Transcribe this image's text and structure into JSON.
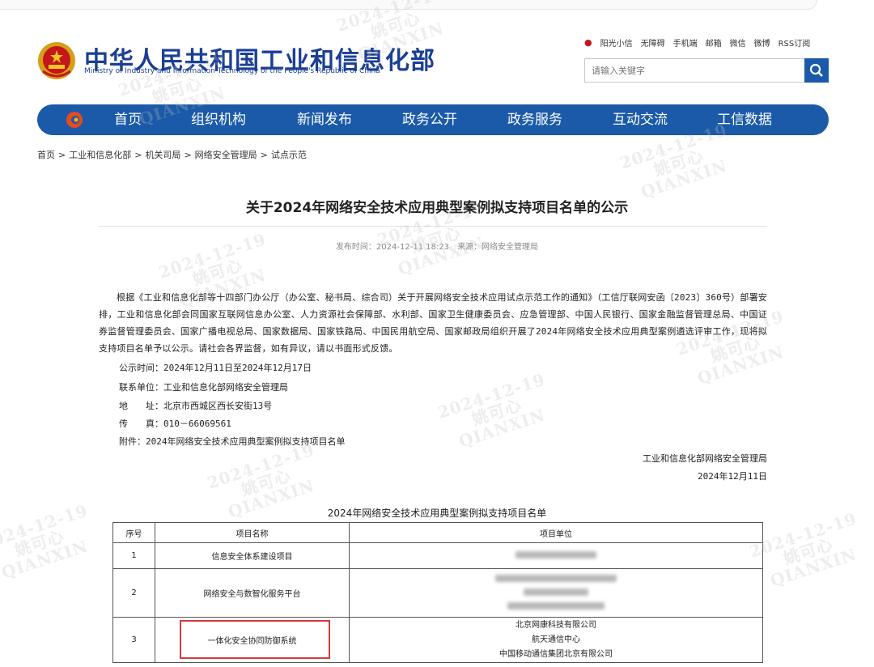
{
  "header": {
    "title_cn": "中华人民共和国工业和信息化部",
    "title_en": "Ministry of Industry and Information Technology of the People's Republic of China",
    "quick_links": [
      "阳光小信",
      "无障碍",
      "手机端",
      "邮箱",
      "微信",
      "微博",
      "RSS订阅"
    ],
    "search_placeholder": "请输入关键字"
  },
  "nav": {
    "items": [
      "首页",
      "组织机构",
      "新闻发布",
      "政务公开",
      "政务服务",
      "互动交流",
      "工信数据"
    ]
  },
  "breadcrumb": [
    "首页",
    "工业和信息化部",
    "机关司局",
    "网络安全管理局",
    "试点示范"
  ],
  "article": {
    "title": "关于2024年网络安全技术应用典型案例拟支持项目名单的公示",
    "publish_time": "发布时间：2024-12-11 18:23",
    "source": "来源：网络安全管理局",
    "paragraph": "根据《工业和信息化部等十四部门办公厅（办公室、秘书局、综合司）关于开展网络安全技术应用试点示范工作的通知》（工信厅联网安函〔2023〕360号）部署安排，工业和信息化部会同国家互联网信息办公室、人力资源社会保障部、水利部、国家卫生健康委员会、应急管理部、中国人民银行、国家金融监督管理总局、中国证券监督管理委员会、国家广播电视总局、国家数据局、国家铁路局、中国民用航空局、国家邮政局组织开展了2024年网络安全技术应用典型案例遴选评审工作，现将拟支持项目名单予以公示。请社会各界监督，如有异议，请以书面形式反馈。",
    "notice_period": "公示时间：2024年12月11日至2024年12月17日",
    "contact_unit": "联系单位：工业和信息化部网络安全管理局",
    "address": "地　　址：北京市西城区西长安街13号",
    "fax": "传　　真：010－66069561",
    "attachment": "附件：2024年网络安全技术应用典型案例拟支持项目名单",
    "signature_org": "工业和信息化部网络安全管理局",
    "signature_date": "2024年12月11日"
  },
  "table": {
    "title": "2024年网络安全技术应用典型案例拟支持项目名单",
    "headers": [
      "序号",
      "项目名称",
      "项目单位"
    ],
    "rows": [
      {
        "no": "1",
        "name": "信息安全体系建设项目",
        "units": []
      },
      {
        "no": "2",
        "name": "网络安全与数智化服务平台",
        "units": []
      },
      {
        "no": "3",
        "name": "一体化安全协同防御系统",
        "units": [
          "北京网康科技有限公司",
          "航天通信中心",
          "中国移动通信集团北京有限公司"
        ]
      }
    ]
  },
  "watermark": {
    "date": "2024-12-19",
    "name": "姚可心",
    "latin": "QIANXIN"
  },
  "colors": {
    "brand_blue": "#1b3f94",
    "nav_blue": "#1b5aa8",
    "highlight_red": "#d63a3a"
  }
}
